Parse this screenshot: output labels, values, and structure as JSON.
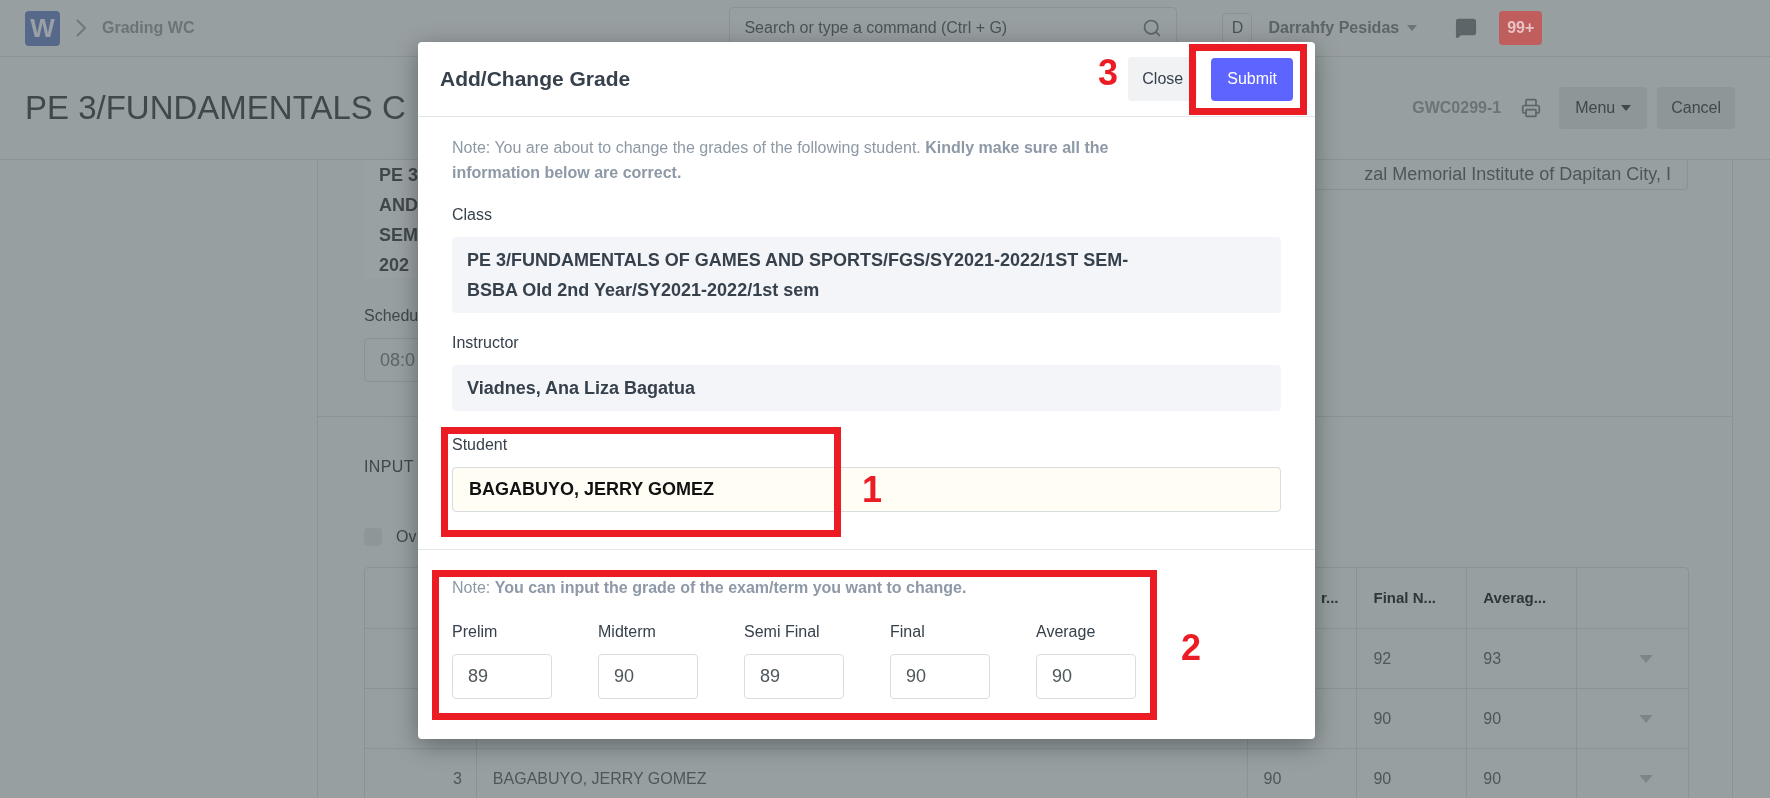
{
  "navbar": {
    "logo": "W",
    "breadcrumb": "Grading WC",
    "search": {
      "placeholder": "Search or type a command (Ctrl + G)"
    },
    "avatar": "D",
    "user": "Darrahfy Pesidas",
    "notifications": "99+"
  },
  "page_header": {
    "title": "PE 3/FUNDAMENTALS C",
    "doc_id": "GWC0299-1",
    "menu": "Menu",
    "cancel": "Cancel"
  },
  "form": {
    "class_field_lines": [
      "PE 3",
      "AND",
      "SEM",
      "202"
    ],
    "institution_field": "zal Memorial Institute of Dapitan City, I",
    "schedule_label": "Schedu",
    "schedule_value": "08:0",
    "section_title": "INPUT",
    "checkbox": {
      "label": "Ov",
      "checked": false
    }
  },
  "table": {
    "columns": [
      "r...",
      "Final N...",
      "Averag..."
    ],
    "rows": [
      {
        "final": "92",
        "average": "93"
      },
      {
        "final": "90",
        "average": "90"
      },
      {
        "index": "3",
        "student": "BAGABUYO, JERRY GOMEZ",
        "column_3": "90",
        "final": "90",
        "average": "90"
      }
    ]
  },
  "dialog": {
    "title": "Add/Change Grade",
    "close": "Close",
    "submit": "Submit",
    "note": "Note: You are about to change the grades of the following student. **Kindly make sure all the information below are correct.**",
    "fields": [
      {
        "label": "Class",
        "value": "PE 3/FUNDAMENTALS OF GAMES AND SPORTS/FGS/SY2021-2022/1ST SEM-BSBA Old 2nd Year/SY2021-2022/1st sem"
      },
      {
        "label": "Instructor",
        "value": "Viadnes, Ana Liza Bagatua"
      }
    ],
    "student": {
      "label": "Student",
      "value": "BAGABUYO, JERRY GOMEZ"
    },
    "grade_note": "Note: **You can input the grade of the exam/term you want to change.**",
    "grades": [
      {
        "label": "Prelim",
        "value": "89"
      },
      {
        "label": "Midterm",
        "value": "90"
      },
      {
        "label": "Semi Final",
        "value": "89"
      },
      {
        "label": "Final",
        "value": "90"
      },
      {
        "label": "Average",
        "value": "90"
      }
    ]
  },
  "annotations": [
    "1",
    "2",
    "3"
  ]
}
